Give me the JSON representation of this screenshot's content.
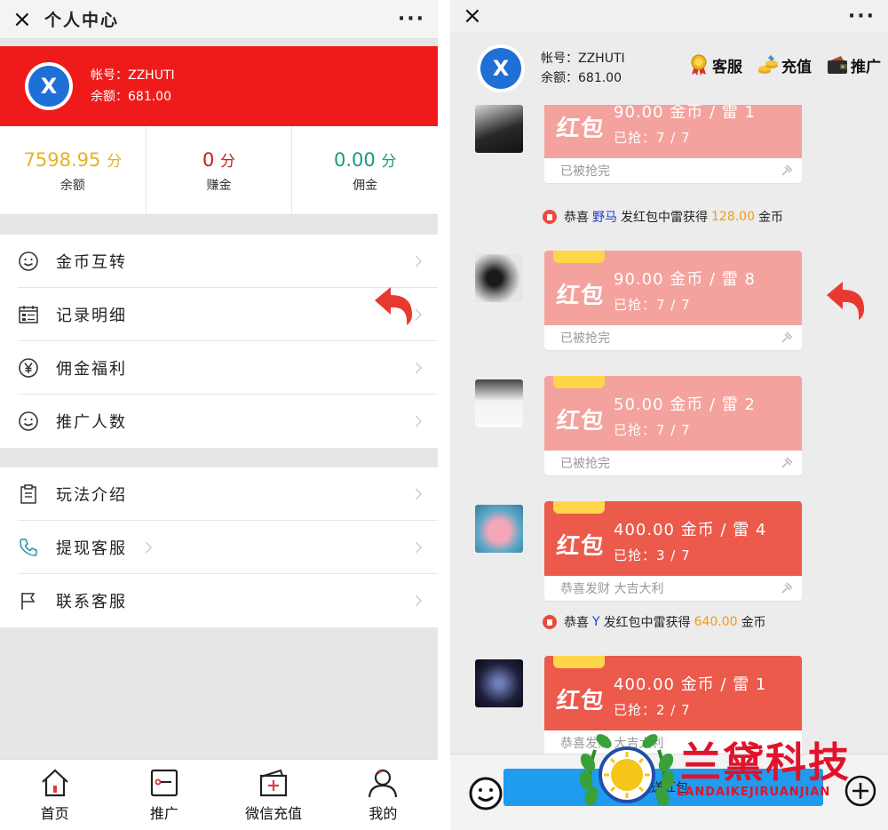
{
  "left": {
    "titlebar": {
      "close": "×",
      "title": "个人中心",
      "more": "···"
    },
    "profile": {
      "logo_text": "X",
      "account": "帐号：ZZHUTI",
      "balance": "余额：681.00"
    },
    "stats": [
      {
        "value": "7598.95",
        "unit": "分",
        "label": "余额",
        "color": "#e6b21f"
      },
      {
        "value": "0",
        "unit": "分",
        "label": "赚金",
        "color": "#c41e1e"
      },
      {
        "value": "0.00",
        "unit": "分",
        "label": "佣金",
        "color": "#1a9a7e"
      }
    ],
    "menu1": [
      {
        "label": "金币互转",
        "icon": "smile-icon"
      },
      {
        "label": "记录明细",
        "icon": "calendar-icon"
      },
      {
        "label": "佣金福利",
        "icon": "yen-icon"
      },
      {
        "label": "推广人数",
        "icon": "smile-icon"
      }
    ],
    "menu2": [
      {
        "label": "玩法介绍",
        "icon": "clipboard-icon"
      },
      {
        "label": "提现客服",
        "icon": "phone-icon"
      },
      {
        "label": "联系客服",
        "icon": "flag-icon"
      }
    ],
    "tabs": [
      {
        "label": "首页",
        "icon": "home-icon"
      },
      {
        "label": "推广",
        "icon": "promote-icon"
      },
      {
        "label": "微信充值",
        "icon": "wallet-icon"
      },
      {
        "label": "我的",
        "icon": "user-icon"
      }
    ]
  },
  "right": {
    "titlebar": {
      "close": "×",
      "more": "···"
    },
    "header": {
      "logo_text": "X",
      "account": "帐号：ZZHUTI",
      "balance": "余额：681.00"
    },
    "actions": [
      {
        "label": "客服",
        "icon": "medal-icon"
      },
      {
        "label": "充值",
        "icon": "coins-icon"
      },
      {
        "label": "推广",
        "icon": "wallet-icon"
      }
    ],
    "messages": [
      {
        "amount": "90.00 金币 / 雷 1",
        "grabbed": "已抢：7 / 7",
        "footer": "已被抢完",
        "color": "#f4a29e",
        "hb": "红包"
      },
      {
        "amount": "90.00 金币 / 雷 8",
        "grabbed": "已抢：7 / 7",
        "footer": "已被抢完",
        "color": "#f4a29e",
        "hb": "红包"
      },
      {
        "amount": "50.00 金币 / 雷 2",
        "grabbed": "已抢：7 / 7",
        "footer": "已被抢完",
        "color": "#f4a29e",
        "hb": "红包"
      },
      {
        "amount": "400.00 金币 / 雷 4",
        "grabbed": "已抢：3 / 7",
        "footer": "恭喜发财 大吉大利",
        "color": "#ec5a4c",
        "hb": "红包"
      },
      {
        "amount": "400.00 金币 / 雷 1",
        "grabbed": "已抢：2 / 7",
        "footer": "恭喜发财 大吉大利",
        "color": "#ec5a4c",
        "hb": "红包"
      }
    ],
    "notes": [
      {
        "pre": "恭喜",
        "who": "野马",
        "mid": "发红包中雷获得",
        "gold": "128.00",
        "post": "金币"
      },
      {
        "pre": "恭喜",
        "who": "Y",
        "mid": "发红包中雷获得",
        "gold": "640.00",
        "post": "金币"
      }
    ],
    "bottom": {
      "send_label": "发送红包"
    }
  },
  "watermark": {
    "title": "兰黛科技",
    "subtitle": "LANDAIKEJIRUANJIAN"
  },
  "colors": {
    "profile_red": "#ef1b1b",
    "send_blue": "#1f9bf0",
    "gold": "#f39b0b"
  }
}
